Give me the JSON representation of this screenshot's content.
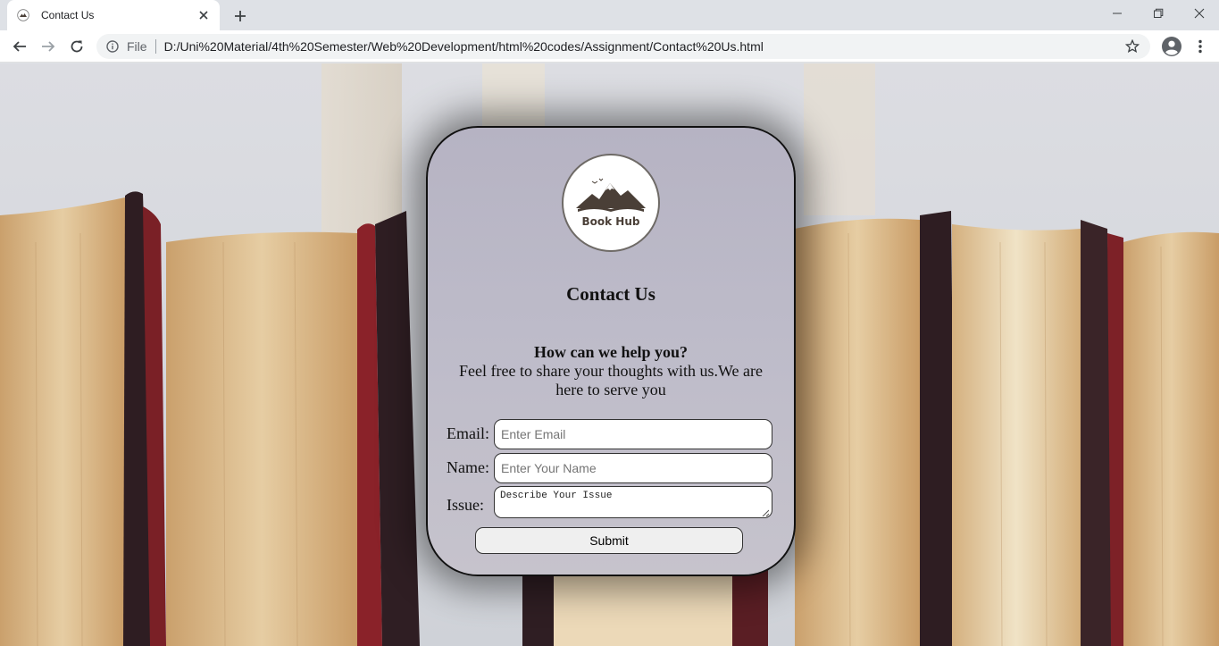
{
  "browser": {
    "tab": {
      "title": "Contact Us",
      "favicon": "book-hub-favicon",
      "close_icon": "close-icon"
    },
    "new_tab_icon": "plus-icon",
    "window_controls": [
      "minimize-icon",
      "restore-icon",
      "close-icon"
    ],
    "address_bar": {
      "security_label": "File",
      "url": "D:/Uni%20Material/4th%20Semester/Web%20Development/html%20codes/Assignment/Contact%20Us.html"
    },
    "nav_icons": [
      "back-arrow-icon",
      "forward-arrow-icon",
      "reload-icon"
    ],
    "right_icons": [
      "star-icon",
      "profile-avatar-icon",
      "more-vert-icon"
    ]
  },
  "page": {
    "background": "books-photo",
    "logo": {
      "text": "Book Hub",
      "icon": "mountain-book-icon"
    },
    "title": "Contact Us",
    "subtitle": "How can we help you?",
    "description": "Feel free to share your thoughts with us.We are here to serve you",
    "form": {
      "email_label": "Email:",
      "email_placeholder": "Enter Email",
      "email_value": "",
      "name_label": "Name:",
      "name_placeholder": "Enter Your Name",
      "name_value": "",
      "issue_label": "Issue:",
      "issue_placeholder": "Describe Your Issue",
      "submit_label": "Submit"
    }
  },
  "colors": {
    "card_bg": "#bdbbc9",
    "chrome_bg": "#dee1e6",
    "book_page": "#d9b98a",
    "book_spine": "#3a2428"
  }
}
